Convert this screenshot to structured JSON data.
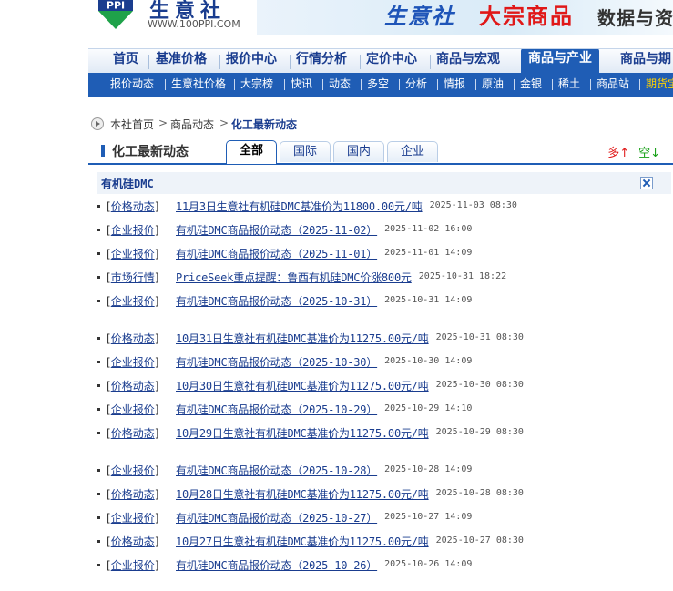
{
  "header": {
    "logo_text": "PPI",
    "site_name": "生意社",
    "site_url": "WWW.100PPI.COM",
    "banner": {
      "part1": "生意社",
      "part2": "大宗商品",
      "part3": "数据与资"
    }
  },
  "nav": {
    "items": [
      "首页",
      "基准价格",
      "报价中心",
      "行情分析",
      "定价中心",
      "商品与宏观",
      "商品与产业",
      "商品与期"
    ],
    "active": "商品与产业"
  },
  "subnav": {
    "items": [
      "报价动态",
      "生意社价格",
      "大宗榜",
      "快讯",
      "动态",
      "多空",
      "分析",
      "情报",
      "原油",
      "金银",
      "稀土",
      "商品站",
      "期货宝"
    ]
  },
  "breadcrumb": {
    "items": [
      "本社首页",
      "商品动态",
      "化工最新动态"
    ],
    "sep": ">"
  },
  "tabbar": {
    "title": "化工最新动态",
    "tabs": [
      "全部",
      "国际",
      "国内",
      "企业"
    ],
    "active": "全部",
    "up_label": "多↑",
    "down_label": "空↓"
  },
  "section": {
    "name": "有机硅DMC"
  },
  "news": [
    {
      "cat": "价格动态",
      "title": "11月3日生意社有机硅DMC基准价为11800.00元/吨",
      "time": "2025-11-03 08:30"
    },
    {
      "cat": "企业报价",
      "title": "有机硅DMC商品报价动态（2025-11-02）",
      "time": "2025-11-02 16:00"
    },
    {
      "cat": "企业报价",
      "title": "有机硅DMC商品报价动态（2025-11-01）",
      "time": "2025-11-01 14:09"
    },
    {
      "cat": "市场行情",
      "title": "PriceSeek重点提醒：鲁西有机硅DMC价涨800元",
      "time": "2025-10-31 18:22"
    },
    {
      "cat": "企业报价",
      "title": "有机硅DMC商品报价动态（2025-10-31）",
      "time": "2025-10-31 14:09"
    },
    {
      "cat": "价格动态",
      "title": "10月31日生意社有机硅DMC基准价为11275.00元/吨",
      "time": "2025-10-31 08:30"
    },
    {
      "cat": "企业报价",
      "title": "有机硅DMC商品报价动态（2025-10-30）",
      "time": "2025-10-30 14:09"
    },
    {
      "cat": "价格动态",
      "title": "10月30日生意社有机硅DMC基准价为11275.00元/吨",
      "time": "2025-10-30 08:30"
    },
    {
      "cat": "企业报价",
      "title": "有机硅DMC商品报价动态（2025-10-29）",
      "time": "2025-10-29 14:10"
    },
    {
      "cat": "价格动态",
      "title": "10月29日生意社有机硅DMC基准价为11275.00元/吨",
      "time": "2025-10-29 08:30"
    },
    {
      "cat": "企业报价",
      "title": "有机硅DMC商品报价动态（2025-10-28）",
      "time": "2025-10-28 14:09"
    },
    {
      "cat": "价格动态",
      "title": "10月28日生意社有机硅DMC基准价为11275.00元/吨",
      "time": "2025-10-28 08:30"
    },
    {
      "cat": "企业报价",
      "title": "有机硅DMC商品报价动态（2025-10-27）",
      "time": "2025-10-27 14:09"
    },
    {
      "cat": "价格动态",
      "title": "10月27日生意社有机硅DMC基准价为11275.00元/吨",
      "time": "2025-10-27 08:30"
    },
    {
      "cat": "企业报价",
      "title": "有机硅DMC商品报价动态（2025-10-26）",
      "time": "2025-10-26 14:09"
    }
  ],
  "colors": {
    "brand": "#1f5db5",
    "up": "#e01818",
    "down": "#16a016",
    "hot": "#ffd200"
  }
}
